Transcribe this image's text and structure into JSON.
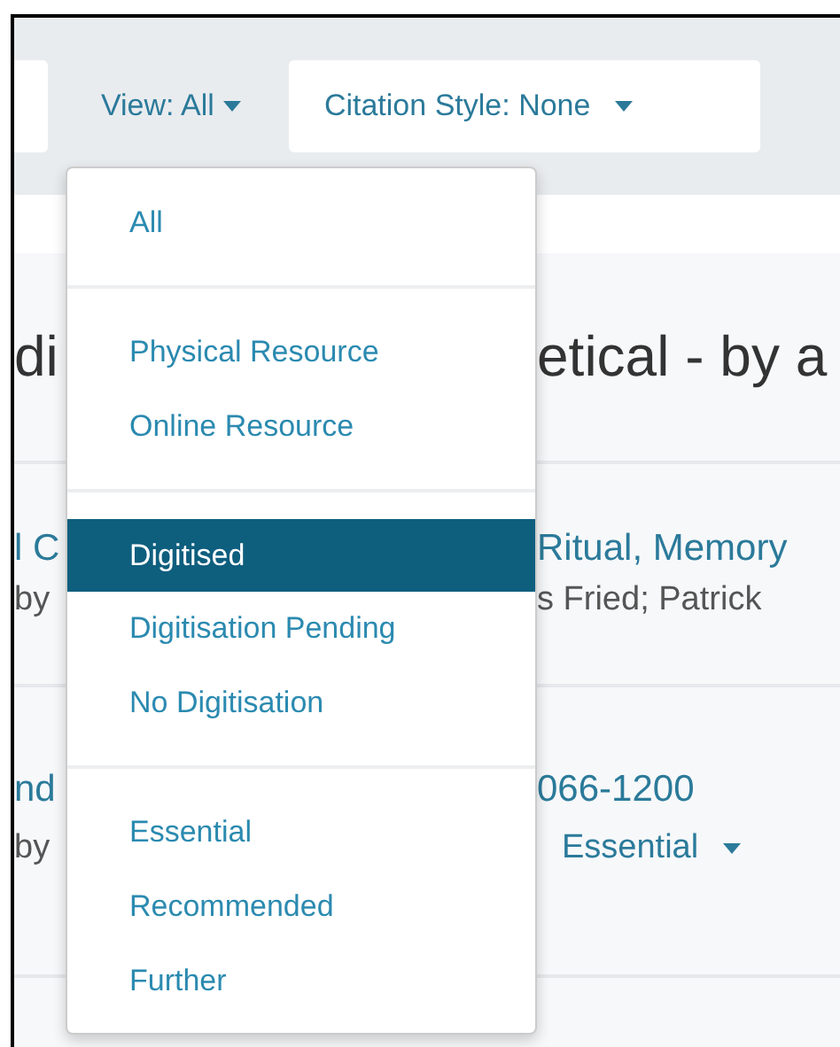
{
  "toolbar": {
    "view_filter": {
      "label": "View: All",
      "expanded": true
    },
    "citation_style": {
      "label": "Citation Style:",
      "value": "None"
    }
  },
  "heading": {
    "left": "di",
    "right": "etical - by a"
  },
  "items": [
    {
      "title_left": "l C",
      "title_right": "Ritual, Memory",
      "byline_left": "by",
      "byline_right": "s Fried; Patrick"
    },
    {
      "title_left": "nd",
      "title_right": "066-1200",
      "byline_left": "by",
      "importance": "Essential"
    }
  ],
  "view_menu": {
    "groups": [
      {
        "items": [
          {
            "label": "All",
            "selected": false
          }
        ]
      },
      {
        "items": [
          {
            "label": "Physical Resource",
            "selected": false
          },
          {
            "label": "Online Resource",
            "selected": false
          }
        ]
      },
      {
        "items": [
          {
            "label": "Digitised",
            "selected": true
          },
          {
            "label": "Digitisation Pending",
            "selected": false
          },
          {
            "label": "No Digitisation",
            "selected": false
          }
        ]
      },
      {
        "items": [
          {
            "label": "Essential",
            "selected": false
          },
          {
            "label": "Recommended",
            "selected": false
          },
          {
            "label": "Further",
            "selected": false
          }
        ]
      }
    ]
  }
}
